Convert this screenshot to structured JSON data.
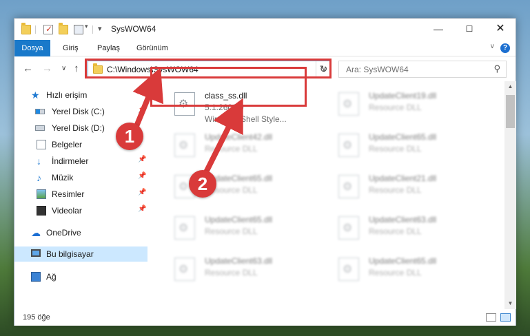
{
  "window": {
    "title": "SysWOW64"
  },
  "ribbon": {
    "tabs": [
      "Dosya",
      "Giriş",
      "Paylaş",
      "Görünüm"
    ]
  },
  "nav": {
    "address": "C:\\Windows\\SysWOW64",
    "search_placeholder": "Ara: SysWOW64"
  },
  "sidebar": {
    "items": [
      {
        "label": "Hızlı erişim",
        "icon": "star-icon"
      },
      {
        "label": "Yerel Disk (C:)",
        "icon": "disk-icon"
      },
      {
        "label": "Yerel Disk (D:)",
        "icon": "disk-icon"
      },
      {
        "label": "Belgeler",
        "icon": "documents-icon"
      },
      {
        "label": "İndirmeler",
        "icon": "downloads-icon"
      },
      {
        "label": "Müzik",
        "icon": "music-icon"
      },
      {
        "label": "Resimler",
        "icon": "pictures-icon"
      },
      {
        "label": "Videolar",
        "icon": "videos-icon"
      },
      {
        "label": "OneDrive",
        "icon": "onedrive-icon"
      },
      {
        "label": "Bu bilgisayar",
        "icon": "computer-icon"
      },
      {
        "label": "Ağ",
        "icon": "network-icon"
      }
    ]
  },
  "files": {
    "selected": {
      "name": "class_ss.dll",
      "version": "5.1.2600.0",
      "desc": "Windows Shell Style..."
    },
    "col2": [
      {
        "name": "UpdateClient19.dll",
        "desc": "Resource DLL"
      },
      {
        "name": "UpdateClient65.dll",
        "desc": "Resource DLL"
      },
      {
        "name": "UpdateClient21.dll",
        "desc": "Resource DLL"
      },
      {
        "name": "UpdateClient63.dll",
        "desc": "Resource DLL"
      },
      {
        "name": "UpdateClient65.dll",
        "desc": "Resource DLL"
      }
    ],
    "col1": [
      {
        "name": "UpdateClient42.dll",
        "desc": "Resource DLL"
      },
      {
        "name": "UpdateClient65.dll",
        "desc": "Resource DLL"
      },
      {
        "name": "UpdateClient65.dll",
        "desc": "Resource DLL"
      },
      {
        "name": "UpdateClient63.dll",
        "desc": "Resource DLL"
      }
    ]
  },
  "status": {
    "count": "195 öğe"
  },
  "annotations": {
    "step1": "1",
    "step2": "2",
    "color": "#d93a3a"
  }
}
